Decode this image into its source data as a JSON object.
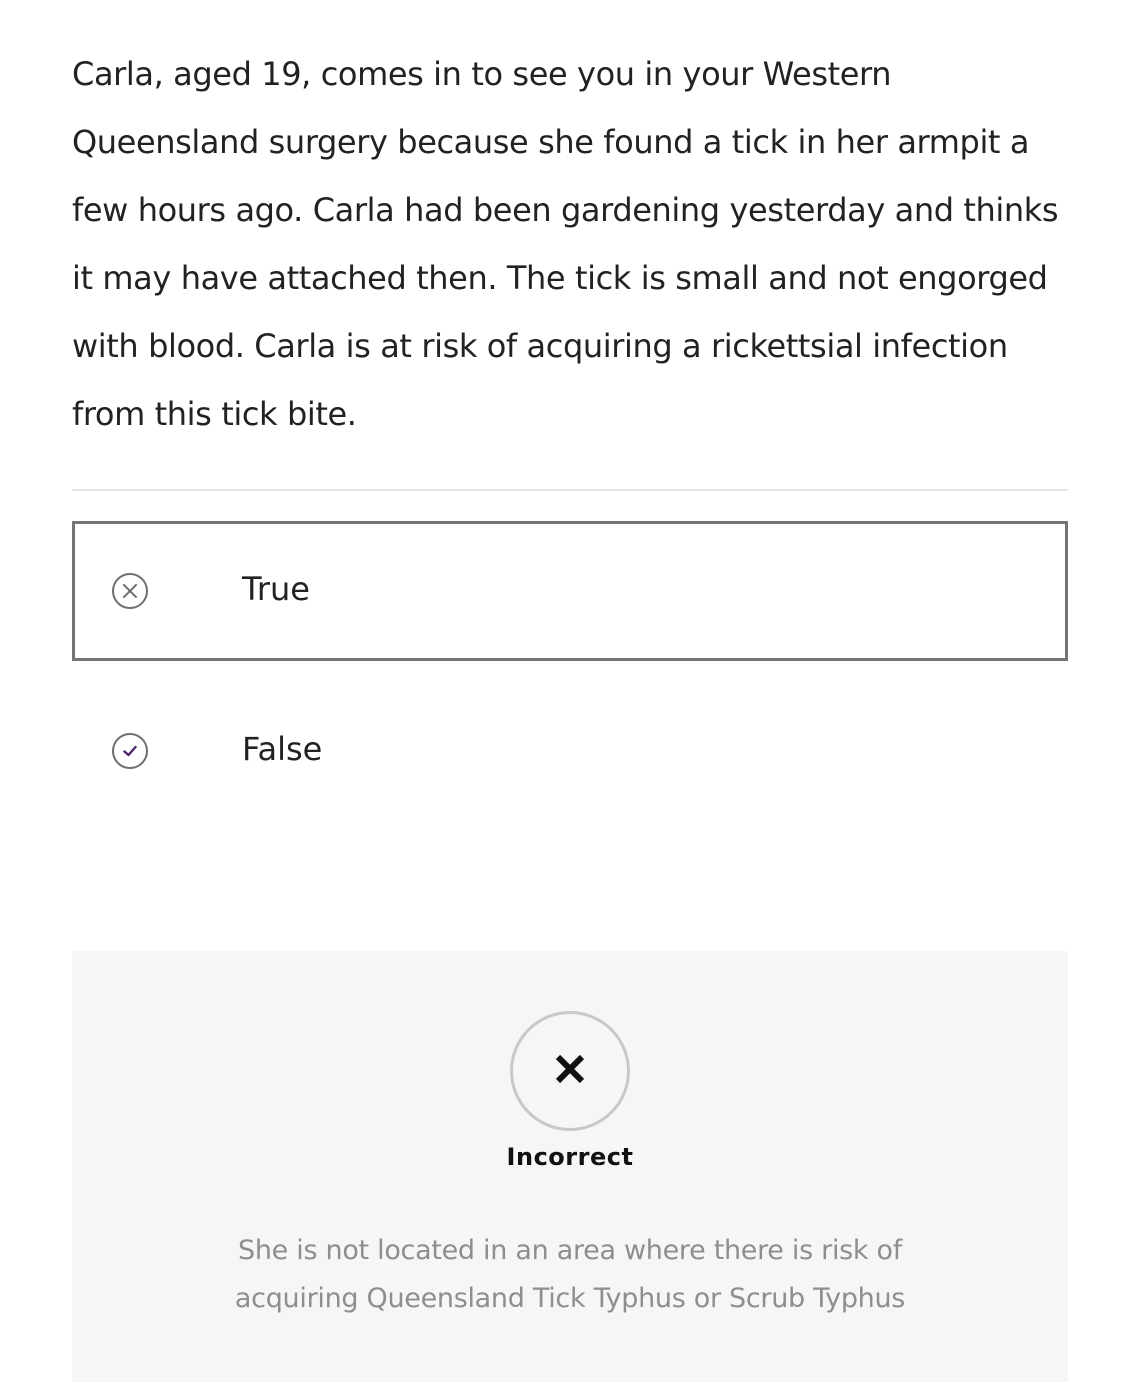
{
  "question": {
    "text": "Carla, aged 19, comes in to see you in your Western Queensland surgery because she found a tick in her armpit a few hours ago. Carla had been gardening yesterday and thinks it may have attached then. The tick is small and not engorged with blood. Carla is at risk of acquiring a rickettsial infection from this tick bite."
  },
  "options": [
    {
      "label": "True",
      "selected": true,
      "icon": "x-circle-icon"
    },
    {
      "label": "False",
      "selected": false,
      "icon": "check-circle-icon"
    }
  ],
  "feedback": {
    "status": "Incorrect",
    "icon": "x-icon",
    "explanation": "She is not located in an area where there is risk of acquiring Queensland Tick Typhus or Scrub Typhus"
  },
  "colors": {
    "selected_border": "#747474",
    "check_mark": "#4b2a6b",
    "feedback_bg": "#f6f6f6",
    "explanation_text": "#8e8e8e"
  }
}
